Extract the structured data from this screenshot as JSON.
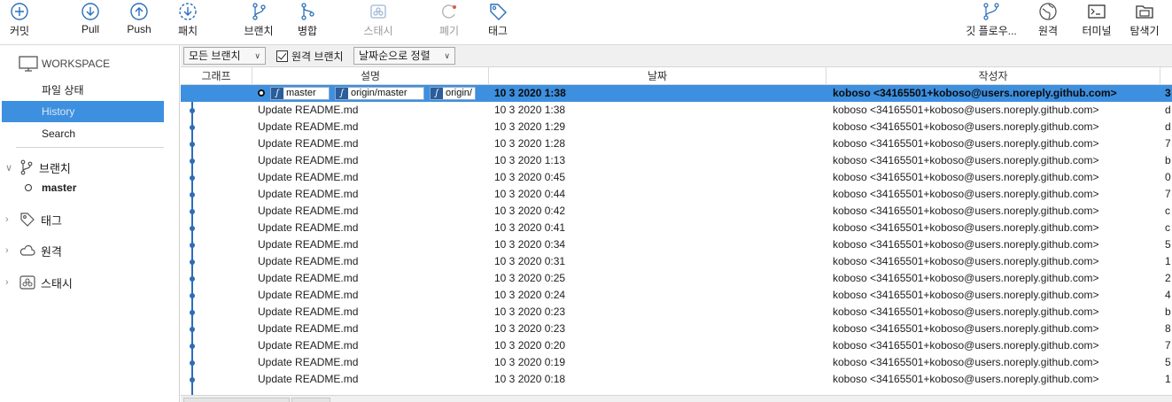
{
  "toolbar": {
    "commit": "커밋",
    "pull": "Pull",
    "push": "Push",
    "fetch": "패치",
    "branch": "브랜치",
    "merge": "병합",
    "stash": "스태시",
    "discard": "폐기",
    "tag": "태그",
    "gitflow": "깃 플로우...",
    "remote": "원격",
    "terminal": "터미널",
    "explorer": "탐색기"
  },
  "sidebar": {
    "workspace": "WORKSPACE",
    "items": [
      "파일 상태",
      "History",
      "Search"
    ],
    "selected_item": "History",
    "branches_label": "브랜치",
    "current_branch": "master",
    "tags_label": "태그",
    "remotes_label": "원격",
    "stashes_label": "스태시"
  },
  "filter": {
    "branches_dropdown": "모든 브랜치",
    "remote_branches_label": "원격 브랜치",
    "remote_branches_checked": true,
    "sort_dropdown": "날짜순으로 정렬"
  },
  "columns": {
    "graph": "그래프",
    "description": "설명",
    "date": "날짜",
    "author": "작성자"
  },
  "head_refs": [
    "master",
    "origin/master",
    "origin/"
  ],
  "commits": [
    {
      "desc": "",
      "date": "10 3 2020 1:38",
      "author": "koboso <34165501+koboso@users.noreply.github.com>",
      "hash": "3"
    },
    {
      "desc": "Update README.md",
      "date": "10 3 2020 1:38",
      "author": "koboso <34165501+koboso@users.noreply.github.com>",
      "hash": "d"
    },
    {
      "desc": "Update README.md",
      "date": "10 3 2020 1:29",
      "author": "koboso <34165501+koboso@users.noreply.github.com>",
      "hash": "d"
    },
    {
      "desc": "Update README.md",
      "date": "10 3 2020 1:28",
      "author": "koboso <34165501+koboso@users.noreply.github.com>",
      "hash": "7"
    },
    {
      "desc": "Update README.md",
      "date": "10 3 2020 1:13",
      "author": "koboso <34165501+koboso@users.noreply.github.com>",
      "hash": "b"
    },
    {
      "desc": "Update README.md",
      "date": "10 3 2020 0:45",
      "author": "koboso <34165501+koboso@users.noreply.github.com>",
      "hash": "0"
    },
    {
      "desc": "Update README.md",
      "date": "10 3 2020 0:44",
      "author": "koboso <34165501+koboso@users.noreply.github.com>",
      "hash": "7"
    },
    {
      "desc": "Update README.md",
      "date": "10 3 2020 0:42",
      "author": "koboso <34165501+koboso@users.noreply.github.com>",
      "hash": "c"
    },
    {
      "desc": "Update README.md",
      "date": "10 3 2020 0:41",
      "author": "koboso <34165501+koboso@users.noreply.github.com>",
      "hash": "c"
    },
    {
      "desc": "Update README.md",
      "date": "10 3 2020 0:34",
      "author": "koboso <34165501+koboso@users.noreply.github.com>",
      "hash": "5"
    },
    {
      "desc": "Update README.md",
      "date": "10 3 2020 0:31",
      "author": "koboso <34165501+koboso@users.noreply.github.com>",
      "hash": "1"
    },
    {
      "desc": "Update README.md",
      "date": "10 3 2020 0:25",
      "author": "koboso <34165501+koboso@users.noreply.github.com>",
      "hash": "2"
    },
    {
      "desc": "Update README.md",
      "date": "10 3 2020 0:24",
      "author": "koboso <34165501+koboso@users.noreply.github.com>",
      "hash": "4"
    },
    {
      "desc": "Update README.md",
      "date": "10 3 2020 0:23",
      "author": "koboso <34165501+koboso@users.noreply.github.com>",
      "hash": "b"
    },
    {
      "desc": "Update README.md",
      "date": "10 3 2020 0:23",
      "author": "koboso <34165501+koboso@users.noreply.github.com>",
      "hash": "8"
    },
    {
      "desc": "Update README.md",
      "date": "10 3 2020 0:20",
      "author": "koboso <34165501+koboso@users.noreply.github.com>",
      "hash": "7"
    },
    {
      "desc": "Update README.md",
      "date": "10 3 2020 0:19",
      "author": "koboso <34165501+koboso@users.noreply.github.com>",
      "hash": "5"
    },
    {
      "desc": "Update README.md",
      "date": "10 3 2020 0:18",
      "author": "koboso <34165501+koboso@users.noreply.github.com>",
      "hash": "1"
    }
  ],
  "colors": {
    "accent": "#3d8fe0",
    "graph_line": "#2e6db4",
    "icon": "#2a6fb8"
  }
}
